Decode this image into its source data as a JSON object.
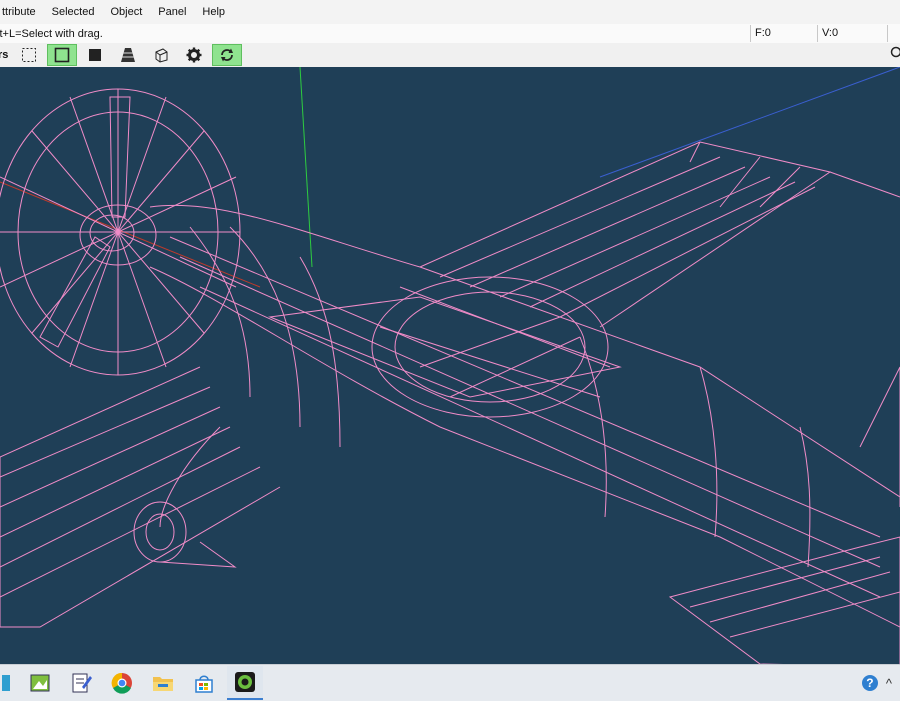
{
  "menu": {
    "items": [
      "ttribute",
      "Selected",
      "Object",
      "Panel",
      "Help"
    ]
  },
  "status": {
    "hint": "ift+L=Select with drag.",
    "faces": "F:0",
    "vertices": "V:0"
  },
  "toolbar": {
    "label": "rs",
    "buttons": [
      {
        "icon": "dotted-rectangle-icon",
        "active": false
      },
      {
        "icon": "wireframe-mode-icon",
        "active": true
      },
      {
        "icon": "solid-mode-icon",
        "active": false
      },
      {
        "icon": "texture-mode-icon",
        "active": false
      },
      {
        "icon": "box-mode-icon",
        "active": false
      },
      {
        "icon": "gear-icon",
        "active": false
      },
      {
        "icon": "refresh-icon",
        "active": true
      }
    ]
  },
  "viewport": {
    "background": "#1f3f57",
    "wire_color": "#f08cc8",
    "axis_colors": {
      "x": "#c0392b",
      "y": "#2ecc40",
      "z": "#3a5fd0"
    },
    "model": "aircraft-wireframe"
  },
  "taskbar": {
    "icons": [
      "app-edge-icon",
      "image-editor-icon",
      "document-editor-icon",
      "chrome-icon",
      "file-explorer-icon",
      "store-icon",
      "metasequoia-icon"
    ],
    "running": "metasequoia-icon"
  },
  "tray": {
    "help": "?",
    "caret": "^"
  }
}
